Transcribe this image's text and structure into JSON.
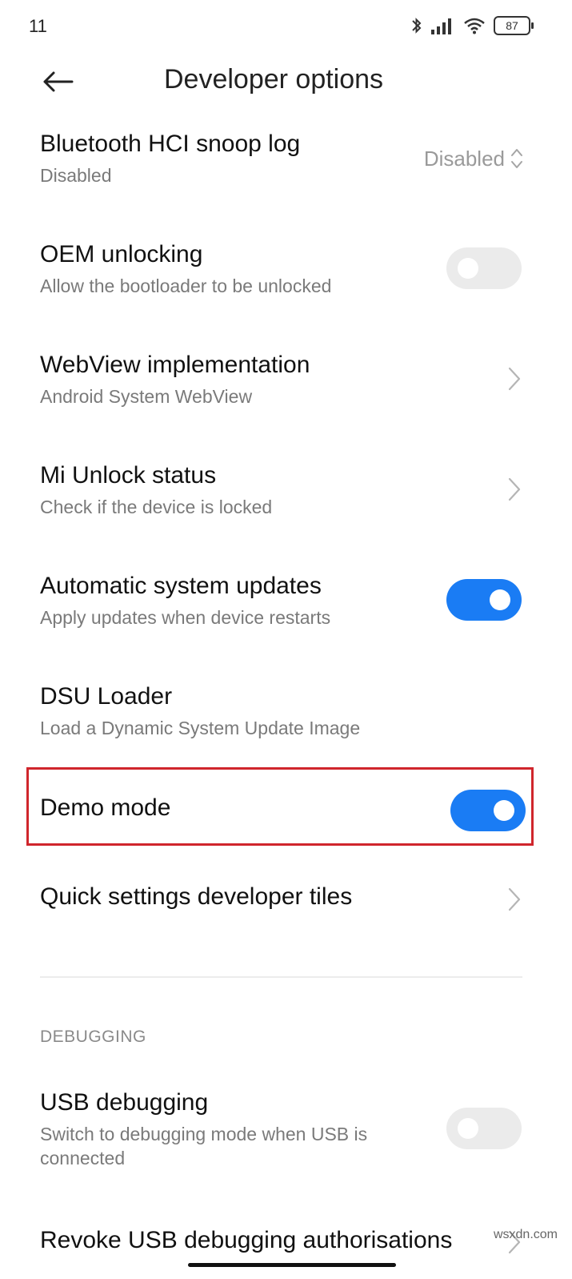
{
  "status_bar": {
    "time": "11",
    "battery": "87"
  },
  "header": {
    "title": "Developer options"
  },
  "rows": [
    {
      "title": "Bluetooth HCI snoop log",
      "subtitle": "Disabled",
      "control": "select",
      "value": "Disabled"
    },
    {
      "title": "OEM unlocking",
      "subtitle": "Allow the bootloader to be unlocked",
      "control": "toggle",
      "on": false
    },
    {
      "title": "WebView implementation",
      "subtitle": "Android System WebView",
      "control": "chevron"
    },
    {
      "title": "Mi Unlock status",
      "subtitle": "Check if the device is locked",
      "control": "chevron"
    },
    {
      "title": "Automatic system updates",
      "subtitle": "Apply updates when device restarts",
      "control": "toggle",
      "on": true
    },
    {
      "title": "DSU Loader",
      "subtitle": "Load a Dynamic System Update Image",
      "control": "none"
    },
    {
      "title": "Demo mode",
      "control": "toggle",
      "on": true,
      "highlighted": true
    },
    {
      "title": "Quick settings developer tiles",
      "control": "chevron"
    }
  ],
  "section": {
    "label": "DEBUGGING"
  },
  "debug_rows": [
    {
      "title": "USB debugging",
      "subtitle": "Switch to debugging mode when USB is connected",
      "control": "toggle",
      "on": false
    },
    {
      "title": "Revoke USB debugging authorisations",
      "control": "chevron"
    }
  ],
  "watermark": "wsxdn.com",
  "colors": {
    "accent": "#1a7cf4",
    "highlight": "#d0262c",
    "toggle_off": "#ebebeb"
  }
}
